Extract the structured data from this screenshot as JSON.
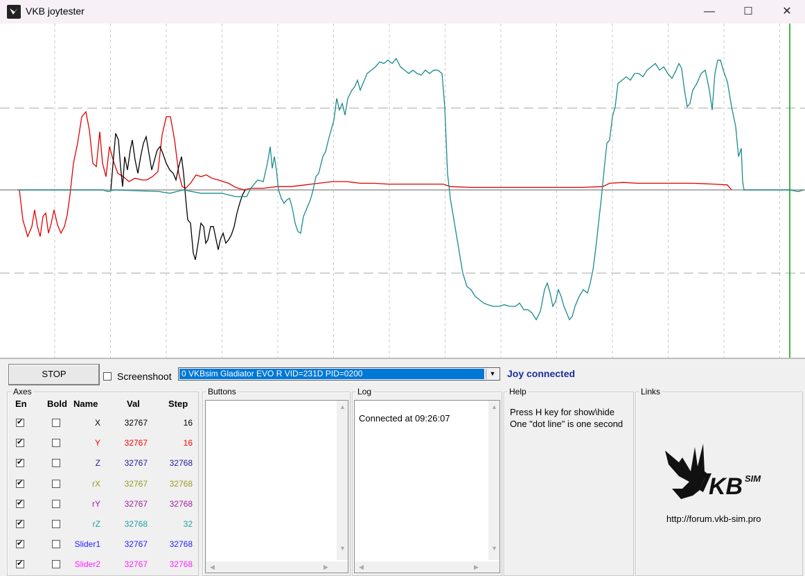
{
  "window": {
    "title": "VKB joytester",
    "minimize": "—",
    "maximize": "☐",
    "close": "✕"
  },
  "toolbar": {
    "stop_label": "STOP",
    "screenshot_label": "Screenshoot",
    "screenshot_checked": false
  },
  "device": {
    "selected": "0  VKBsim Gladiator EVO R   VID=231D PID=0200",
    "status": "Joy connected",
    "status_color": "#1d2b9e"
  },
  "axes": {
    "title": "Axes",
    "headers": {
      "en": "En",
      "bold": "Bold",
      "name": "Name",
      "val": "Val",
      "step": "Step"
    },
    "rows": [
      {
        "name": "X",
        "val": "32767",
        "step": "16",
        "color": "#000000",
        "en": true,
        "bold": false
      },
      {
        "name": "Y",
        "val": "32767",
        "step": "16",
        "color": "#ff0000",
        "en": true,
        "bold": false
      },
      {
        "name": "Z",
        "val": "32767",
        "step": "32768",
        "color": "#1a1aa0",
        "en": true,
        "bold": false
      },
      {
        "name": "rX",
        "val": "32767",
        "step": "32768",
        "color": "#9a9a20",
        "en": true,
        "bold": false
      },
      {
        "name": "rY",
        "val": "32767",
        "step": "32768",
        "color": "#a020a0",
        "en": true,
        "bold": false
      },
      {
        "name": "rZ",
        "val": "32768",
        "step": "32",
        "color": "#20a0a0",
        "en": true,
        "bold": false
      },
      {
        "name": "Slider1",
        "val": "32767",
        "step": "32768",
        "color": "#2020ff",
        "en": true,
        "bold": false
      },
      {
        "name": "Slider2",
        "val": "32767",
        "step": "32768",
        "color": "#ff20ff",
        "en": true,
        "bold": false
      }
    ]
  },
  "buttons_group": {
    "title": "Buttons"
  },
  "log": {
    "title": "Log",
    "lines": [
      "Connected at 09:26:07"
    ]
  },
  "help": {
    "title": "Help",
    "line1": "Press H key for show\\hide",
    "line2": "One \"dot line\" is one second"
  },
  "links": {
    "title": "Links",
    "logo_text": "KB",
    "logo_sup": "SIM",
    "url": "http://forum.vkb-sim.pro"
  },
  "colors": {
    "trace_x": "#000000",
    "trace_y": "#e00000",
    "trace_rz": "#1a8a8a",
    "marker": "#00a000"
  }
}
